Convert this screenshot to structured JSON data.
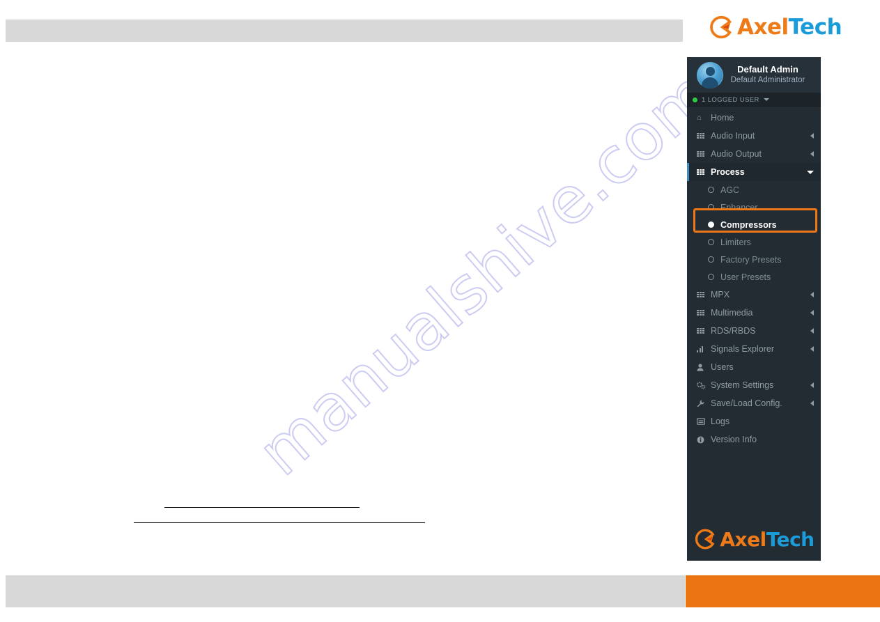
{
  "brand": {
    "name_part1": "Axel",
    "name_part2": "Tech",
    "mark": "axeltech-logo-mark",
    "orange": "#ee7b17",
    "blue": "#1b9cd9"
  },
  "watermark": {
    "text": "manualshive.com"
  },
  "sidebar": {
    "user": {
      "avatar": "user-avatar-icon",
      "name": "Default Admin",
      "role": "Default Administrator"
    },
    "logged_bar": {
      "status_dot": "online-status-dot",
      "label": "1 LOGGED USER",
      "caret": "caret-down-icon"
    },
    "items": [
      {
        "label": "Home",
        "icon": "home-icon",
        "expandable": false,
        "active": false
      },
      {
        "label": "Audio Input",
        "icon": "grid-icon",
        "expandable": true,
        "active": false
      },
      {
        "label": "Audio Output",
        "icon": "grid-icon",
        "expandable": true,
        "active": false
      },
      {
        "label": "Process",
        "icon": "grid-icon",
        "expandable": true,
        "active": true,
        "expanded": true
      },
      {
        "label": "MPX",
        "icon": "grid-icon",
        "expandable": true,
        "active": false
      },
      {
        "label": "Multimedia",
        "icon": "grid-icon",
        "expandable": true,
        "active": false
      },
      {
        "label": "RDS/RBDS",
        "icon": "grid-icon",
        "expandable": true,
        "active": false
      },
      {
        "label": "Signals Explorer",
        "icon": "bar-chart-icon",
        "expandable": true,
        "active": false
      },
      {
        "label": "Users",
        "icon": "user-icon",
        "expandable": false,
        "active": false
      },
      {
        "label": "System Settings",
        "icon": "gears-icon",
        "expandable": true,
        "active": false
      },
      {
        "label": "Save/Load Config.",
        "icon": "wrench-icon",
        "expandable": true,
        "active": false
      },
      {
        "label": "Logs",
        "icon": "list-icon",
        "expandable": false,
        "active": false
      },
      {
        "label": "Version Info",
        "icon": "info-icon",
        "expandable": false,
        "active": false
      }
    ],
    "process_submenu": [
      {
        "label": "AGC",
        "selected": false
      },
      {
        "label": "Enhancer",
        "selected": false
      },
      {
        "label": "Compressors",
        "selected": true,
        "highlighted": true
      },
      {
        "label": "Limiters",
        "selected": false
      },
      {
        "label": "Factory Presets",
        "selected": false
      },
      {
        "label": "User Presets",
        "selected": false
      }
    ],
    "footer_logo": "axeltech-logo"
  },
  "annotation": {
    "target": "Compressors",
    "color": "#ee7717"
  },
  "footer": {
    "accent_color": "#ea7412",
    "bar_color": "#d8d8d8"
  }
}
